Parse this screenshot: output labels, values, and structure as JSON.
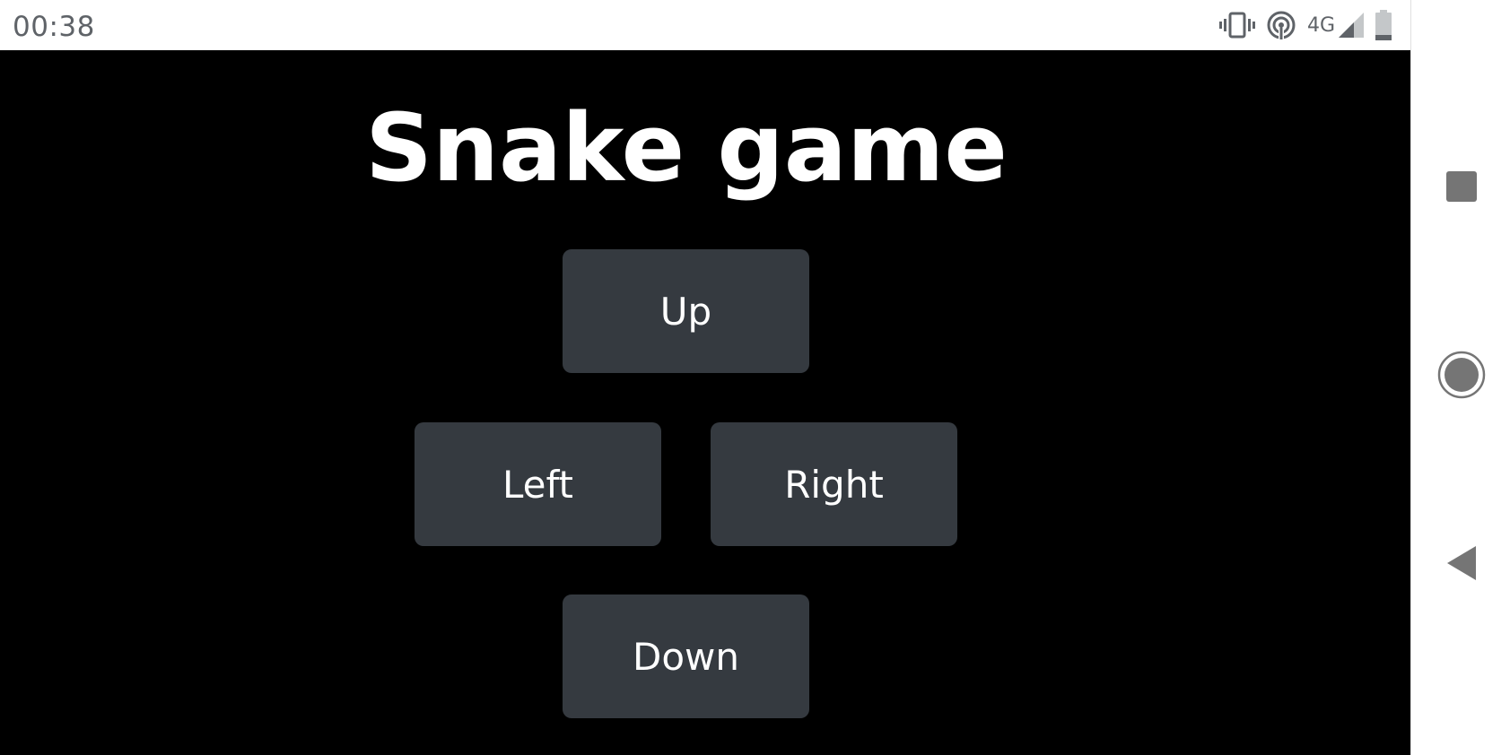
{
  "status_bar": {
    "time": "00:38",
    "network_label": "4G",
    "icons": [
      "vibrate-icon",
      "hotspot-icon",
      "cellular-signal-icon",
      "battery-icon"
    ]
  },
  "app": {
    "title": "Snake game",
    "background_color": "#000000",
    "button_color": "#353a40",
    "buttons": {
      "up": "Up",
      "left": "Left",
      "right": "Right",
      "down": "Down"
    }
  },
  "nav_bar": {
    "icons": [
      "recents-icon",
      "home-icon",
      "back-icon"
    ]
  }
}
